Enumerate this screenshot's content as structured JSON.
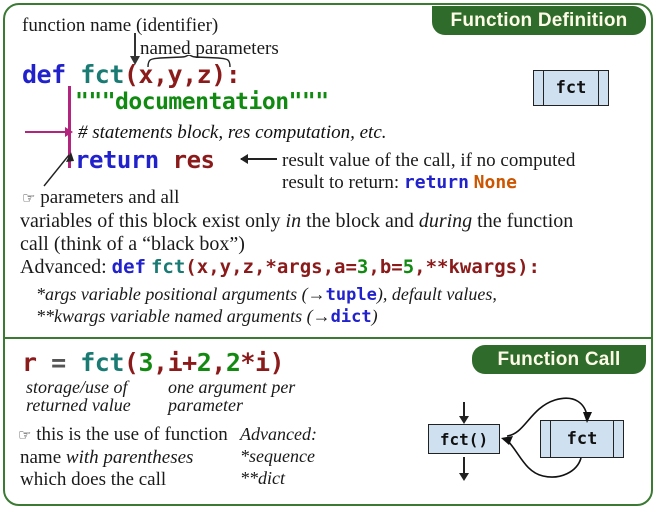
{
  "panel": {
    "border_color": "#3a7a33",
    "badge_color": "#2f6b2a",
    "badge_text_color": "#fdfbe7"
  },
  "sections": {
    "definition": {
      "badge": "Function Definition",
      "annotations": {
        "function_name": "function name (identifier)",
        "named_parameters": "named parameters"
      },
      "code": {
        "def_keyword": "def",
        "fct_name": "fct",
        "params": "(x,y,z):",
        "docstring": "\"\"\"documentation\"\"\"",
        "statements_comment": "# statements block, res computation, etc.",
        "return_keyword": "return",
        "return_value": "res"
      },
      "result_note": {
        "line1": "result value of the call, if no computed",
        "line2_prefix": "result to return:",
        "line2_code_kw": "return",
        "line2_code_none": "None"
      },
      "scope_note": {
        "icon": "pointing-hand-icon",
        "line1": "parameters and all",
        "line2_a": "variables of this block exist only ",
        "line2_b": "in",
        "line2_c": " the block and ",
        "line2_d": "during",
        "line2_e": " the function",
        "line3": "call (think of a “black box”)"
      },
      "advanced": {
        "label": "Advanced:",
        "code_def": "def",
        "code_fct": "fct",
        "code_open": "(",
        "code_params": "x,y,z,*args,",
        "code_a": "a=",
        "code_a_num": "3",
        "code_comma1": ",",
        "code_b": "b=",
        "code_b_num": "5",
        "code_tail": ",**kwargs):",
        "sub1_a": "*args variable positional arguments (→",
        "sub1_type": "tuple",
        "sub1_b": "), default values,",
        "sub2_a": "**kwargs variable named arguments (→",
        "sub2_type": "dict",
        "sub2_b": ")"
      },
      "box_label": "fct"
    },
    "call": {
      "badge": "Function Call",
      "code": {
        "var": "r",
        "equals": "=",
        "fct_name": "fct",
        "open_paren": "(",
        "arg1": "3",
        "comma1": ",",
        "arg2_var": "i",
        "arg2_op": "+",
        "arg2_num": "2",
        "comma2": ",",
        "arg3_num": "2",
        "arg3_op": "*",
        "arg3_var": "i",
        "close_paren": ")"
      },
      "labels": {
        "left1": "storage/use of",
        "left2": "returned value",
        "right1": "one argument per",
        "right2": "parameter"
      },
      "use_note": {
        "icon": "pointing-hand-icon",
        "line1": "this is the use of function",
        "line2_a": "name ",
        "line2_b": "with parentheses",
        "line3": "which does the call"
      },
      "advanced": {
        "label": "Advanced:",
        "line1": "*sequence",
        "line2": "**dict"
      },
      "diagram": {
        "call_box": "fct()",
        "fct_box": "fct"
      }
    }
  }
}
